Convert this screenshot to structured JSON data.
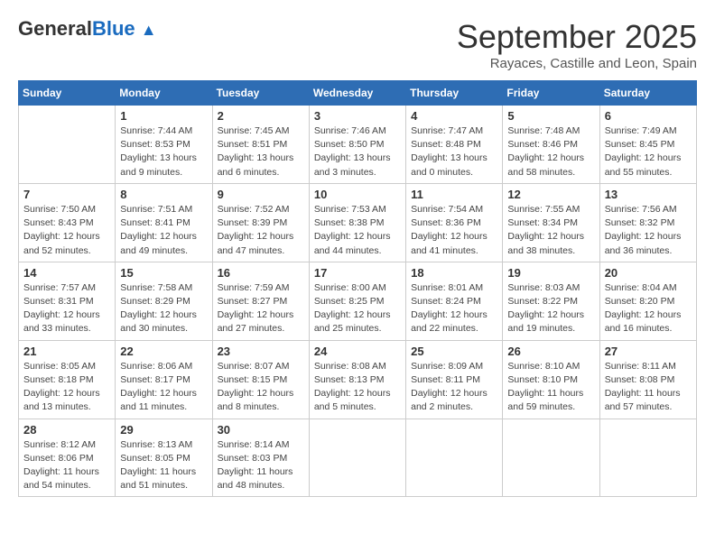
{
  "header": {
    "logo_general": "General",
    "logo_blue": "Blue",
    "month_title": "September 2025",
    "location": "Rayaces, Castille and Leon, Spain"
  },
  "weekdays": [
    "Sunday",
    "Monday",
    "Tuesday",
    "Wednesday",
    "Thursday",
    "Friday",
    "Saturday"
  ],
  "weeks": [
    [
      {
        "day": "",
        "info": ""
      },
      {
        "day": "1",
        "info": "Sunrise: 7:44 AM\nSunset: 8:53 PM\nDaylight: 13 hours\nand 9 minutes."
      },
      {
        "day": "2",
        "info": "Sunrise: 7:45 AM\nSunset: 8:51 PM\nDaylight: 13 hours\nand 6 minutes."
      },
      {
        "day": "3",
        "info": "Sunrise: 7:46 AM\nSunset: 8:50 PM\nDaylight: 13 hours\nand 3 minutes."
      },
      {
        "day": "4",
        "info": "Sunrise: 7:47 AM\nSunset: 8:48 PM\nDaylight: 13 hours\nand 0 minutes."
      },
      {
        "day": "5",
        "info": "Sunrise: 7:48 AM\nSunset: 8:46 PM\nDaylight: 12 hours\nand 58 minutes."
      },
      {
        "day": "6",
        "info": "Sunrise: 7:49 AM\nSunset: 8:45 PM\nDaylight: 12 hours\nand 55 minutes."
      }
    ],
    [
      {
        "day": "7",
        "info": "Sunrise: 7:50 AM\nSunset: 8:43 PM\nDaylight: 12 hours\nand 52 minutes."
      },
      {
        "day": "8",
        "info": "Sunrise: 7:51 AM\nSunset: 8:41 PM\nDaylight: 12 hours\nand 49 minutes."
      },
      {
        "day": "9",
        "info": "Sunrise: 7:52 AM\nSunset: 8:39 PM\nDaylight: 12 hours\nand 47 minutes."
      },
      {
        "day": "10",
        "info": "Sunrise: 7:53 AM\nSunset: 8:38 PM\nDaylight: 12 hours\nand 44 minutes."
      },
      {
        "day": "11",
        "info": "Sunrise: 7:54 AM\nSunset: 8:36 PM\nDaylight: 12 hours\nand 41 minutes."
      },
      {
        "day": "12",
        "info": "Sunrise: 7:55 AM\nSunset: 8:34 PM\nDaylight: 12 hours\nand 38 minutes."
      },
      {
        "day": "13",
        "info": "Sunrise: 7:56 AM\nSunset: 8:32 PM\nDaylight: 12 hours\nand 36 minutes."
      }
    ],
    [
      {
        "day": "14",
        "info": "Sunrise: 7:57 AM\nSunset: 8:31 PM\nDaylight: 12 hours\nand 33 minutes."
      },
      {
        "day": "15",
        "info": "Sunrise: 7:58 AM\nSunset: 8:29 PM\nDaylight: 12 hours\nand 30 minutes."
      },
      {
        "day": "16",
        "info": "Sunrise: 7:59 AM\nSunset: 8:27 PM\nDaylight: 12 hours\nand 27 minutes."
      },
      {
        "day": "17",
        "info": "Sunrise: 8:00 AM\nSunset: 8:25 PM\nDaylight: 12 hours\nand 25 minutes."
      },
      {
        "day": "18",
        "info": "Sunrise: 8:01 AM\nSunset: 8:24 PM\nDaylight: 12 hours\nand 22 minutes."
      },
      {
        "day": "19",
        "info": "Sunrise: 8:03 AM\nSunset: 8:22 PM\nDaylight: 12 hours\nand 19 minutes."
      },
      {
        "day": "20",
        "info": "Sunrise: 8:04 AM\nSunset: 8:20 PM\nDaylight: 12 hours\nand 16 minutes."
      }
    ],
    [
      {
        "day": "21",
        "info": "Sunrise: 8:05 AM\nSunset: 8:18 PM\nDaylight: 12 hours\nand 13 minutes."
      },
      {
        "day": "22",
        "info": "Sunrise: 8:06 AM\nSunset: 8:17 PM\nDaylight: 12 hours\nand 11 minutes."
      },
      {
        "day": "23",
        "info": "Sunrise: 8:07 AM\nSunset: 8:15 PM\nDaylight: 12 hours\nand 8 minutes."
      },
      {
        "day": "24",
        "info": "Sunrise: 8:08 AM\nSunset: 8:13 PM\nDaylight: 12 hours\nand 5 minutes."
      },
      {
        "day": "25",
        "info": "Sunrise: 8:09 AM\nSunset: 8:11 PM\nDaylight: 12 hours\nand 2 minutes."
      },
      {
        "day": "26",
        "info": "Sunrise: 8:10 AM\nSunset: 8:10 PM\nDaylight: 11 hours\nand 59 minutes."
      },
      {
        "day": "27",
        "info": "Sunrise: 8:11 AM\nSunset: 8:08 PM\nDaylight: 11 hours\nand 57 minutes."
      }
    ],
    [
      {
        "day": "28",
        "info": "Sunrise: 8:12 AM\nSunset: 8:06 PM\nDaylight: 11 hours\nand 54 minutes."
      },
      {
        "day": "29",
        "info": "Sunrise: 8:13 AM\nSunset: 8:05 PM\nDaylight: 11 hours\nand 51 minutes."
      },
      {
        "day": "30",
        "info": "Sunrise: 8:14 AM\nSunset: 8:03 PM\nDaylight: 11 hours\nand 48 minutes."
      },
      {
        "day": "",
        "info": ""
      },
      {
        "day": "",
        "info": ""
      },
      {
        "day": "",
        "info": ""
      },
      {
        "day": "",
        "info": ""
      }
    ]
  ]
}
